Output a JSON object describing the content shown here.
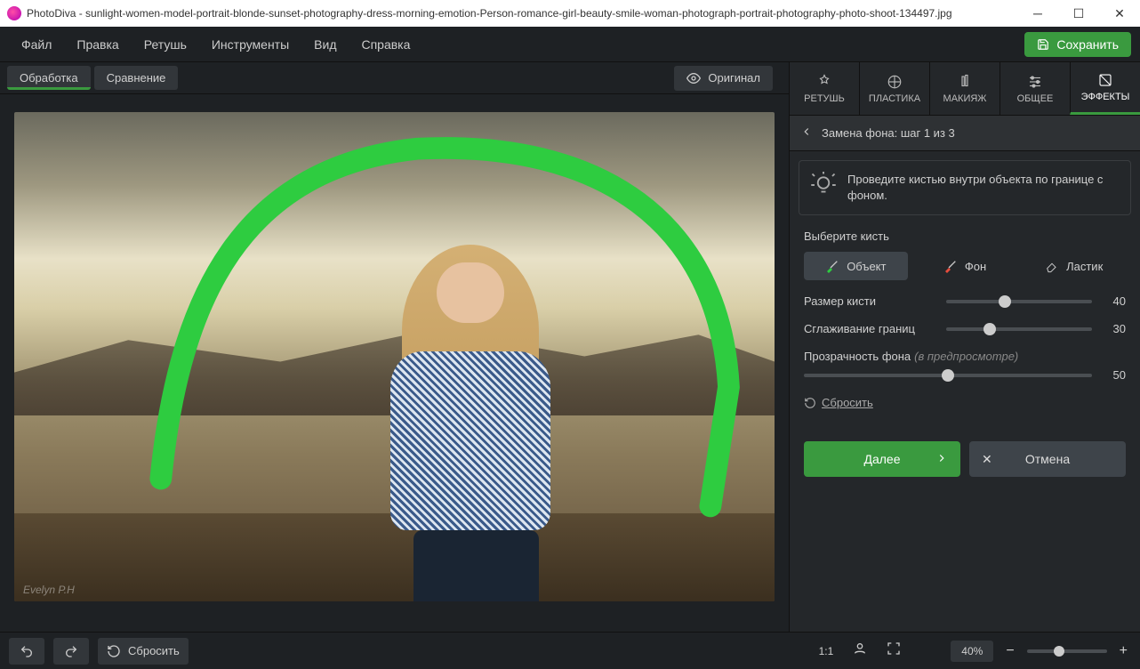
{
  "title": "PhotoDiva - sunlight-women-model-portrait-blonde-sunset-photography-dress-morning-emotion-Person-romance-girl-beauty-smile-woman-photograph-portrait-photography-photo-shoot-134497.jpg",
  "menu": {
    "file": "Файл",
    "edit": "Правка",
    "retouch": "Ретушь",
    "tools": "Инструменты",
    "view": "Вид",
    "help": "Справка",
    "save": "Сохранить"
  },
  "canvas_tabs": {
    "edit": "Обработка",
    "compare": "Сравнение",
    "original": "Оригинал"
  },
  "watermark": "Evelyn P.H",
  "tool_tabs": {
    "retouch": "РЕТУШЬ",
    "plastic": "ПЛАСТИКА",
    "makeup": "МАКИЯЖ",
    "general": "ОБЩЕЕ",
    "effects": "ЭФФЕКТЫ"
  },
  "stepbar": "Замена фона: шаг 1 из 3",
  "hint": "Проведите кистью внутри объекта по границе с фоном.",
  "brush_label": "Выберите кисть",
  "brushes": {
    "object": "Объект",
    "bg": "Фон",
    "eraser": "Ластик"
  },
  "sliders": {
    "size": {
      "label": "Размер кисти",
      "value": "40"
    },
    "smooth": {
      "label": "Сглаживание границ",
      "value": "30"
    },
    "opacity": {
      "label": "Прозрачность фона",
      "sub": "(в предпросмотре)",
      "value": "50"
    }
  },
  "reset": "Сбросить",
  "next": "Далее",
  "cancel": "Отмена",
  "bottom": {
    "reset": "Сбросить",
    "ratio": "1:1",
    "zoom": "40%"
  }
}
